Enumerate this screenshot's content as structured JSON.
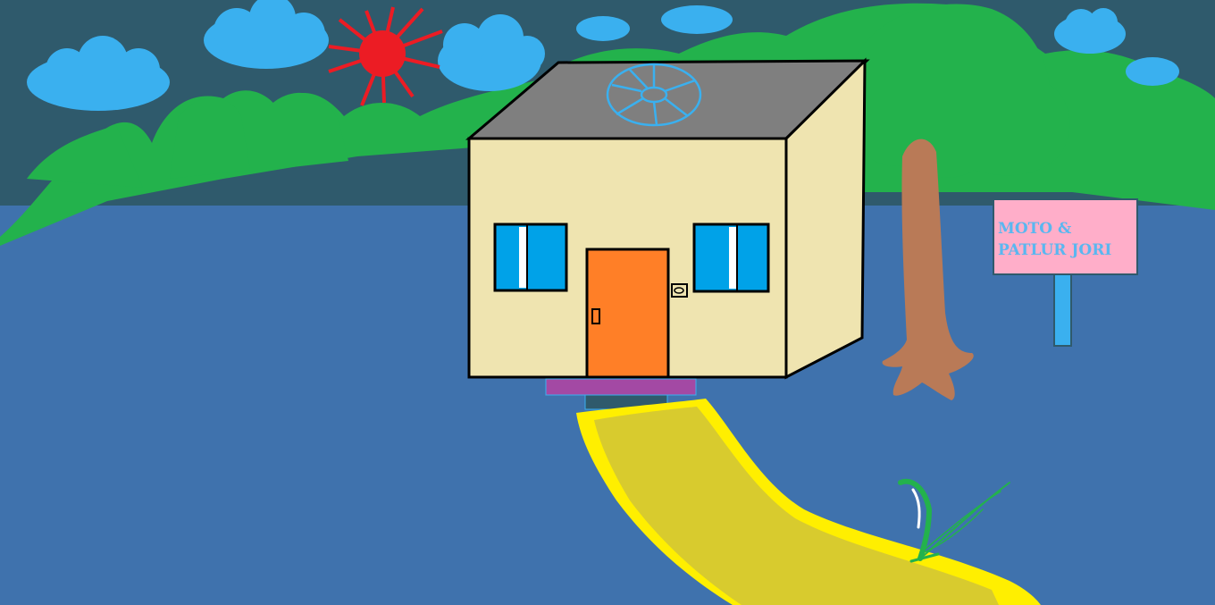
{
  "scene": {
    "sign": {
      "line1": "MOTO &",
      "line2": "PATLUR JORI"
    },
    "colors": {
      "sky": "#2f5a6c",
      "ground": "#3f72ad",
      "hills": "#23b24c",
      "clouds": "#3ab0ef",
      "sun": "#ec1c24",
      "house_wall": "#efe4b0",
      "roof": "#7f7f7f",
      "door": "#ff7f27",
      "windows": "#00a2e8",
      "doormat": "#a349a4",
      "path": "#d8cb2e",
      "tree_trunk": "#b97a57",
      "sign_board": "#ffaec9"
    }
  }
}
